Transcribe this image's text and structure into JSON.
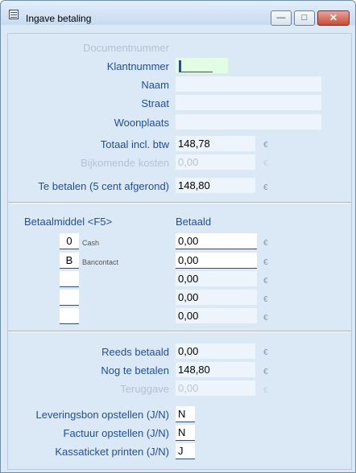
{
  "window": {
    "title": "Ingave betaling",
    "min_label": "—",
    "max_label": "□",
    "close_label": "✕"
  },
  "labels": {
    "documentnummer": "Documentnummer",
    "klantnummer": "Klantnummer",
    "naam": "Naam",
    "straat": "Straat",
    "woonplaats": "Woonplaats",
    "totaal": "Totaal incl. btw",
    "bijkomende": "Bijkomende kosten",
    "te_betalen": "Te betalen (5 cent afgerond)",
    "betaalmiddel": "Betaalmiddel <F5>",
    "betaald": "Betaald",
    "reeds_betaald": "Reeds betaald",
    "nog_te_betalen": "Nog te betalen",
    "teruggave": "Teruggave",
    "leveringsbon": "Leveringsbon opstellen (J/N)",
    "factuur": "Factuur opstellen (J/N)",
    "kassaticket": "Kassaticket printen (J/N)"
  },
  "values": {
    "klantnummer": "",
    "naam": "",
    "straat": "",
    "woonplaats": "",
    "totaal": "148,78",
    "bijkomende": "0,00",
    "te_betalen": "148,80",
    "reeds_betaald": "0,00",
    "nog_te_betalen": "148,80",
    "teruggave": "0,00",
    "leveringsbon": "N",
    "factuur": "N",
    "kassaticket": "J"
  },
  "currency": "€",
  "payments": [
    {
      "code": "0",
      "name": "Cash",
      "amount": "0,00"
    },
    {
      "code": "B",
      "name": "Bancontact",
      "amount": "0,00"
    },
    {
      "code": "",
      "name": "",
      "amount": "0,00"
    },
    {
      "code": "",
      "name": "",
      "amount": "0,00"
    },
    {
      "code": "",
      "name": "",
      "amount": "0,00"
    }
  ]
}
